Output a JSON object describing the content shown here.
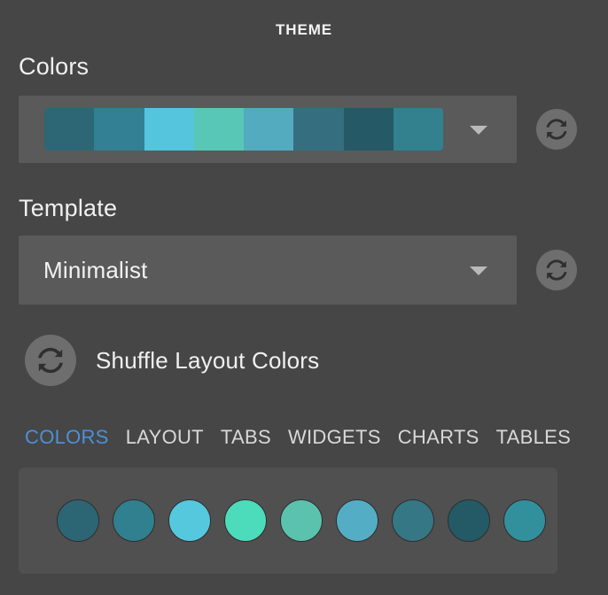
{
  "header": {
    "title": "THEME"
  },
  "colors_section": {
    "label": "Colors",
    "refresh_icon": "refresh-icon",
    "caret_icon": "chevron-down-icon",
    "palette": [
      "#2d6776",
      "#337f93",
      "#54c5dd",
      "#59c7b6",
      "#53abbf",
      "#356f7f",
      "#255965",
      "#33808f"
    ]
  },
  "template_section": {
    "label": "Template",
    "selected": "Minimalist",
    "refresh_icon": "refresh-icon",
    "caret_icon": "chevron-down-icon"
  },
  "shuffle": {
    "label": "Shuffle Layout Colors",
    "icon": "shuffle-refresh-icon"
  },
  "tabs": {
    "active": "COLORS",
    "accent_color": "#4a90d9",
    "items": [
      {
        "label": "COLORS",
        "active": true
      },
      {
        "label": "LAYOUT",
        "active": false
      },
      {
        "label": "TABS",
        "active": false
      },
      {
        "label": "WIDGETS",
        "active": false
      },
      {
        "label": "CHARTS",
        "active": false
      },
      {
        "label": "TABLES",
        "active": false
      }
    ]
  },
  "swatch_tray": {
    "circles": [
      "#2c6675",
      "#30808f",
      "#55c8de",
      "#4ddcbb",
      "#5bc2ad",
      "#53aec5",
      "#357784",
      "#235a66",
      "#31909c"
    ]
  },
  "theme_colors": {
    "page_background": "#464646",
    "control_background": "#5a5a5a",
    "tray_background": "#505050",
    "icon_button_background": "#6e6e6e",
    "icon_glyph": "#2f2f2f",
    "text_primary": "#f0f0f0",
    "accent": "#4a90d9"
  }
}
